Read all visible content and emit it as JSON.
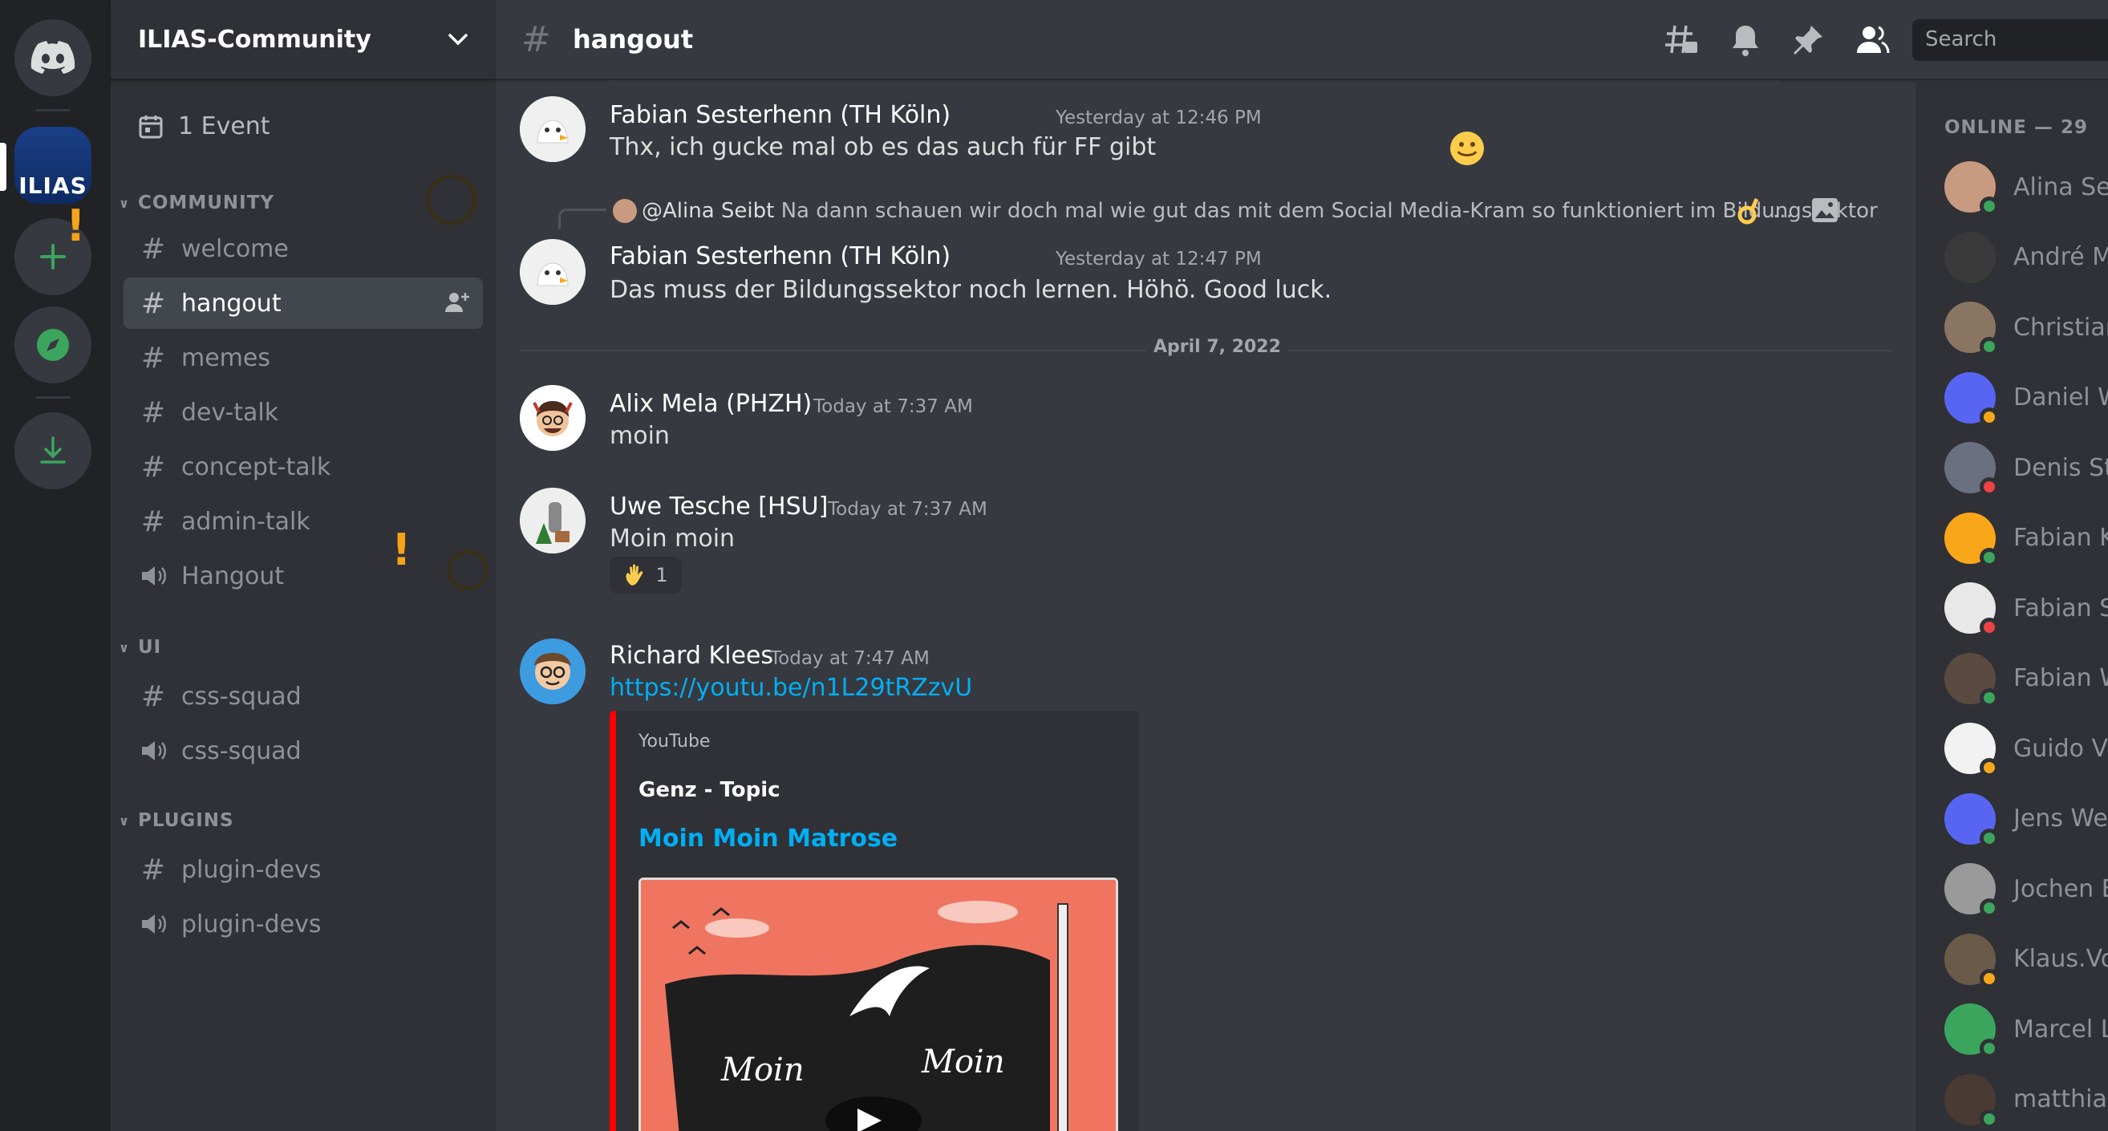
{
  "server": {
    "name": "ILIAS-Community",
    "icon_label": "ILIAS"
  },
  "sidebar": {
    "event_label": "1 Event",
    "categories": [
      {
        "label": "COMMUNITY",
        "channels": [
          {
            "name": "welcome",
            "type": "text"
          },
          {
            "name": "hangout",
            "type": "text"
          },
          {
            "name": "memes",
            "type": "text"
          },
          {
            "name": "dev-talk",
            "type": "text"
          },
          {
            "name": "concept-talk",
            "type": "text"
          },
          {
            "name": "admin-talk",
            "type": "text"
          },
          {
            "name": "Hangout",
            "type": "voice"
          }
        ]
      },
      {
        "label": "UI",
        "channels": [
          {
            "name": "css-squad",
            "type": "text"
          },
          {
            "name": "css-squad",
            "type": "voice"
          }
        ]
      },
      {
        "label": "PLUGINS",
        "channels": [
          {
            "name": "plugin-devs",
            "type": "text"
          },
          {
            "name": "plugin-devs",
            "type": "voice"
          }
        ]
      }
    ]
  },
  "topbar": {
    "channel": "hangout",
    "search_placeholder": "Search"
  },
  "messages": {
    "m1": {
      "author": "Fabian Sesterhenn (TH Köln)",
      "time": "Yesterday at 12:46 PM",
      "text": "Thx, ich gucke mal ob es das auch für FF gibt"
    },
    "m2_reply": {
      "mention": "@Alina Seibt",
      "text": "Na dann schauen wir doch mal wie gut das mit dem Social Media-Kram so funktioniert im Bildungssektor",
      "ellipsis": "..."
    },
    "m2": {
      "author": "Fabian Sesterhenn (TH Köln)",
      "time": "Yesterday at 12:47 PM",
      "text": "Das muss der Bildungssektor noch lernen. Höhö. Good luck."
    },
    "date_divider": "April 7, 2022",
    "m3": {
      "author": "Alix Mela (PHZH)",
      "time": "Today at 7:37 AM",
      "text": "moin"
    },
    "m4": {
      "author": "Uwe Tesche [HSU]",
      "time": "Today at 7:37 AM",
      "text": "Moin moin",
      "reaction_count": "1"
    },
    "m5": {
      "author": "Richard Klees",
      "time": "Today at 7:47 AM",
      "link": "https://youtu.be/n1L29tRZzvU",
      "embed": {
        "provider": "YouTube",
        "title": "Genz - Topic",
        "link_title": "Moin Moin Matrose",
        "thumb_word_1": "Moin",
        "thumb_word_2": "Moin"
      }
    }
  },
  "members": {
    "header": "ONLINE — 29",
    "list": [
      {
        "name": "Alina Sei",
        "status": "online",
        "color": "#c89a80"
      },
      {
        "name": "André M",
        "status": "none",
        "color": "#3a3a3a"
      },
      {
        "name": "Christian",
        "status": "online",
        "color": "#8a7563"
      },
      {
        "name": "Daniel W",
        "status": "idle",
        "color": "#5865f2"
      },
      {
        "name": "Denis St",
        "status": "dnd",
        "color": "#6a7080"
      },
      {
        "name": "Fabian K",
        "status": "online",
        "color": "#faa61a"
      },
      {
        "name": "Fabian S",
        "status": "dnd",
        "color": "#e8e8e8"
      },
      {
        "name": "Fabian W",
        "status": "online",
        "color": "#5a4a40"
      },
      {
        "name": "Guido V",
        "status": "idle",
        "color": "#f2f2f2"
      },
      {
        "name": "Jens We",
        "status": "online",
        "color": "#5865f2"
      },
      {
        "name": "Jochen E",
        "status": "online",
        "color": "#9a9a9a"
      },
      {
        "name": "Klaus.Vo",
        "status": "idle",
        "color": "#6a5a4a"
      },
      {
        "name": "Marcel L",
        "status": "online",
        "color": "#3ba55d"
      },
      {
        "name": "matthias",
        "status": "online",
        "color": "#4a3a34"
      }
    ]
  },
  "colors": {
    "online": "#3ba55d",
    "idle": "#faa61a",
    "dnd": "#ed4245",
    "link": "#00aff4",
    "youtube": "#ff0000"
  }
}
